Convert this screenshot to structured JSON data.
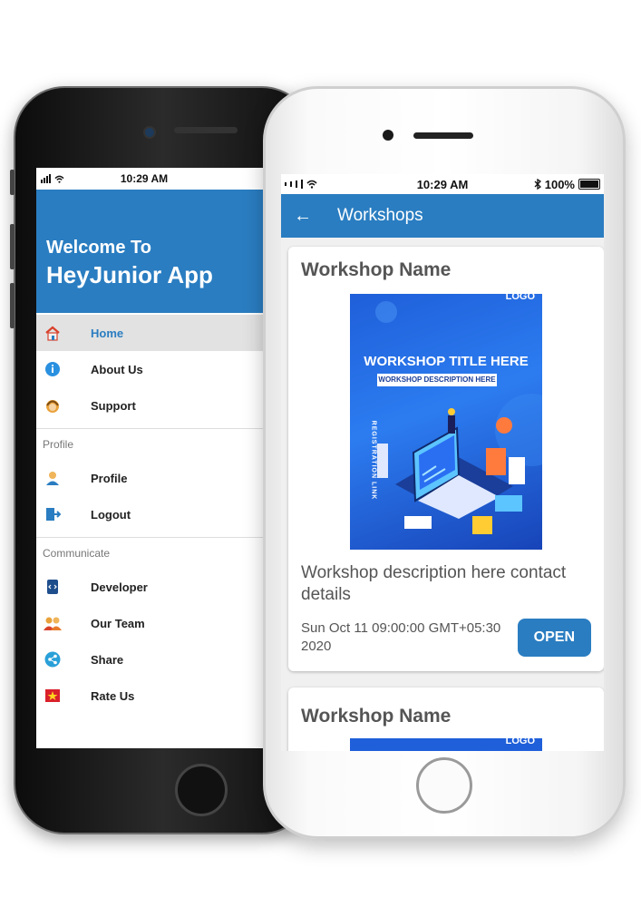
{
  "back_phone": {
    "status_time": "10:29 AM",
    "header": {
      "line1": "Welcome To",
      "line2": "HeyJunior App"
    },
    "menu": [
      {
        "label": "Home",
        "icon": "home-icon",
        "active": true
      },
      {
        "label": "About Us",
        "icon": "info-icon"
      },
      {
        "label": "Support",
        "icon": "support-icon"
      }
    ],
    "section_profile": "Profile",
    "profile_menu": [
      {
        "label": "Profile",
        "icon": "person-icon"
      },
      {
        "label": "Logout",
        "icon": "logout-icon"
      }
    ],
    "section_communicate": "Communicate",
    "communicate_menu": [
      {
        "label": "Developer",
        "icon": "developer-icon"
      },
      {
        "label": "Our Team",
        "icon": "team-icon"
      },
      {
        "label": "Share",
        "icon": "share-icon"
      },
      {
        "label": "Rate Us",
        "icon": "star-icon"
      }
    ]
  },
  "front_phone": {
    "status_time": "10:29 AM",
    "battery": "100%",
    "appbar_title": "Workshops",
    "cards": [
      {
        "title": "Workshop Name",
        "poster": {
          "logo": "LOGO",
          "title": "WORKSHOP TITLE HERE",
          "description": "WORKSHOP DESCRIPTION HERE",
          "side_text": "REGISTRATION LINK"
        },
        "description": "Workshop description here contact details",
        "date": "Sun Oct 11 09:00:00 GMT+05:30 2020",
        "button": "OPEN"
      },
      {
        "title": "Workshop Name",
        "poster": {
          "logo": "LOGO"
        }
      }
    ]
  },
  "colors": {
    "primary": "#2a7dc1",
    "active_bg": "#e2e2e2"
  }
}
